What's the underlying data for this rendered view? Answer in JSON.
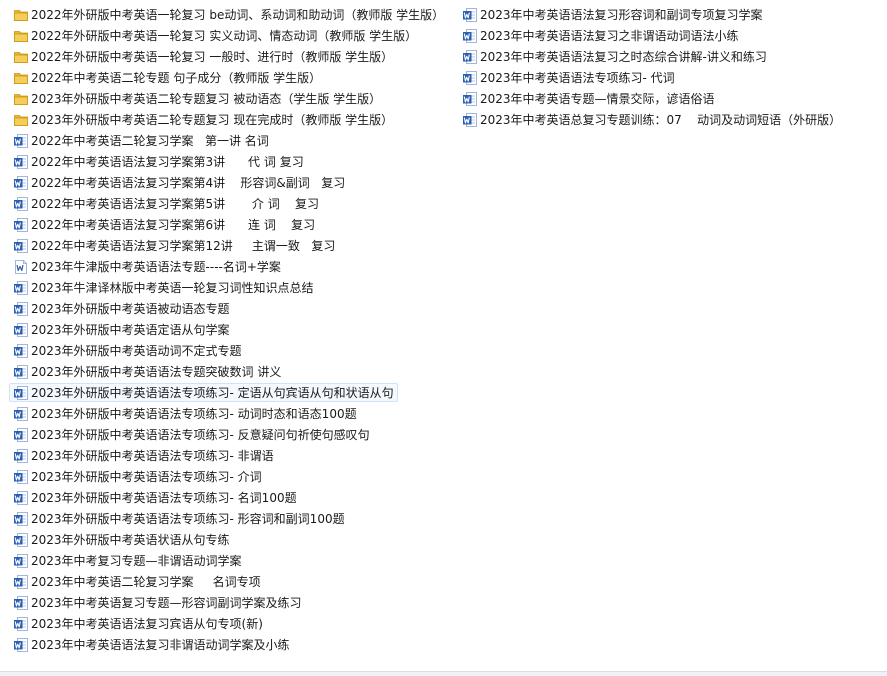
{
  "files": {
    "left": [
      {
        "name": "2022年外研版中考英语一轮复习 be动词、系动词和助动词（教师版 学生版）",
        "icon": "folder-icon"
      },
      {
        "name": "2022年外研版中考英语一轮复习 实义动词、情态动词（教师版 学生版）",
        "icon": "folder-icon"
      },
      {
        "name": "2022年外研版中考英语一轮复习 一般时、进行时（教师版 学生版）",
        "icon": "folder-icon"
      },
      {
        "name": "2022年中考英语二轮专题 句子成分（教师版 学生版）",
        "icon": "folder-icon"
      },
      {
        "name": "2023年外研版中考英语二轮专题复习 被动语态（学生版 学生版）",
        "icon": "folder-icon"
      },
      {
        "name": "2023年外研版中考英语二轮专题复习 现在完成时（教师版 学生版）",
        "icon": "folder-icon"
      },
      {
        "name": "2022年中考英语二轮复习学案   第一讲 名词",
        "icon": "word-doc-icon"
      },
      {
        "name": "2022年中考英语语法复习学案第3讲      代 词 复习",
        "icon": "word-doc-icon"
      },
      {
        "name": "2022年中考英语语法复习学案第4讲    形容词&副词   复习",
        "icon": "word-doc-icon"
      },
      {
        "name": "2022年中考英语语法复习学案第5讲       介 词    复习",
        "icon": "word-doc-icon"
      },
      {
        "name": "2022年中考英语语法复习学案第6讲      连 词    复习",
        "icon": "word-doc-icon"
      },
      {
        "name": "2022年中考英语语法复习学案第12讲     主谓一致   复习",
        "icon": "word-doc-icon"
      },
      {
        "name": "2023年牛津版中考英语语法专题----名词+学案",
        "icon": "word-legacy-icon"
      },
      {
        "name": "2023年牛津译林版中考英语一轮复习词性知识点总结",
        "icon": "word-doc-icon"
      },
      {
        "name": "2023年外研版中考英语被动语态专题",
        "icon": "word-doc-icon"
      },
      {
        "name": "2023年外研版中考英语定语从句学案",
        "icon": "word-doc-icon"
      },
      {
        "name": "2023年外研版中考英语动词不定式专题",
        "icon": "word-doc-icon"
      },
      {
        "name": "2023年外研版中考英语语法专题突破数词 讲义",
        "icon": "word-doc-icon"
      },
      {
        "name": "2023年外研版中考英语语法专项练习- 定语从句宾语从句和状语从句",
        "icon": "word-doc-icon",
        "selected": true
      },
      {
        "name": "2023年外研版中考英语语法专项练习- 动词时态和语态100题",
        "icon": "word-doc-icon"
      },
      {
        "name": "2023年外研版中考英语语法专项练习- 反意疑问句祈使句感叹句",
        "icon": "word-doc-icon"
      },
      {
        "name": "2023年外研版中考英语语法专项练习- 非谓语",
        "icon": "word-doc-icon"
      },
      {
        "name": "2023年外研版中考英语语法专项练习- 介词",
        "icon": "word-doc-icon"
      },
      {
        "name": "2023年外研版中考英语语法专项练习- 名词100题",
        "icon": "word-doc-icon"
      },
      {
        "name": "2023年外研版中考英语语法专项练习- 形容词和副词100题",
        "icon": "word-doc-icon"
      },
      {
        "name": "2023年外研版中考英语状语从句专练",
        "icon": "word-doc-icon"
      },
      {
        "name": "2023年中考复习专题—非谓语动词学案",
        "icon": "word-doc-icon"
      },
      {
        "name": "2023年中考英语二轮复习学案     名词专项",
        "icon": "word-doc-icon"
      },
      {
        "name": "2023年中考英语复习专题—形容词副词学案及练习",
        "icon": "word-doc-icon"
      },
      {
        "name": "2023年中考英语语法复习宾语从句专项(新)",
        "icon": "word-doc-icon"
      },
      {
        "name": "2023年中考英语语法复习非谓语动词学案及小练",
        "icon": "word-doc-icon"
      }
    ],
    "right": [
      {
        "name": "2023年中考英语语法复习形容词和副词专项复习学案",
        "icon": "word-doc-icon"
      },
      {
        "name": "2023年中考英语语法复习之非谓语动词语法小练",
        "icon": "word-doc-icon"
      },
      {
        "name": "2023年中考英语语法复习之时态综合讲解-讲义和练习",
        "icon": "word-doc-icon"
      },
      {
        "name": "2023年中考英语语法专项练习- 代词",
        "icon": "word-doc-icon"
      },
      {
        "name": "2023年中考英语专题—情景交际，谚语俗语",
        "icon": "word-doc-icon"
      },
      {
        "name": "2023年中考英语总复习专题训练：07    动词及动词短语（外研版）",
        "icon": "word-doc-icon"
      }
    ]
  },
  "colors": {
    "folder": "#e8b731",
    "word": "#2b5fb4",
    "selection_border": "#cfe3fc",
    "selection_fill": "#f4f9ff"
  }
}
